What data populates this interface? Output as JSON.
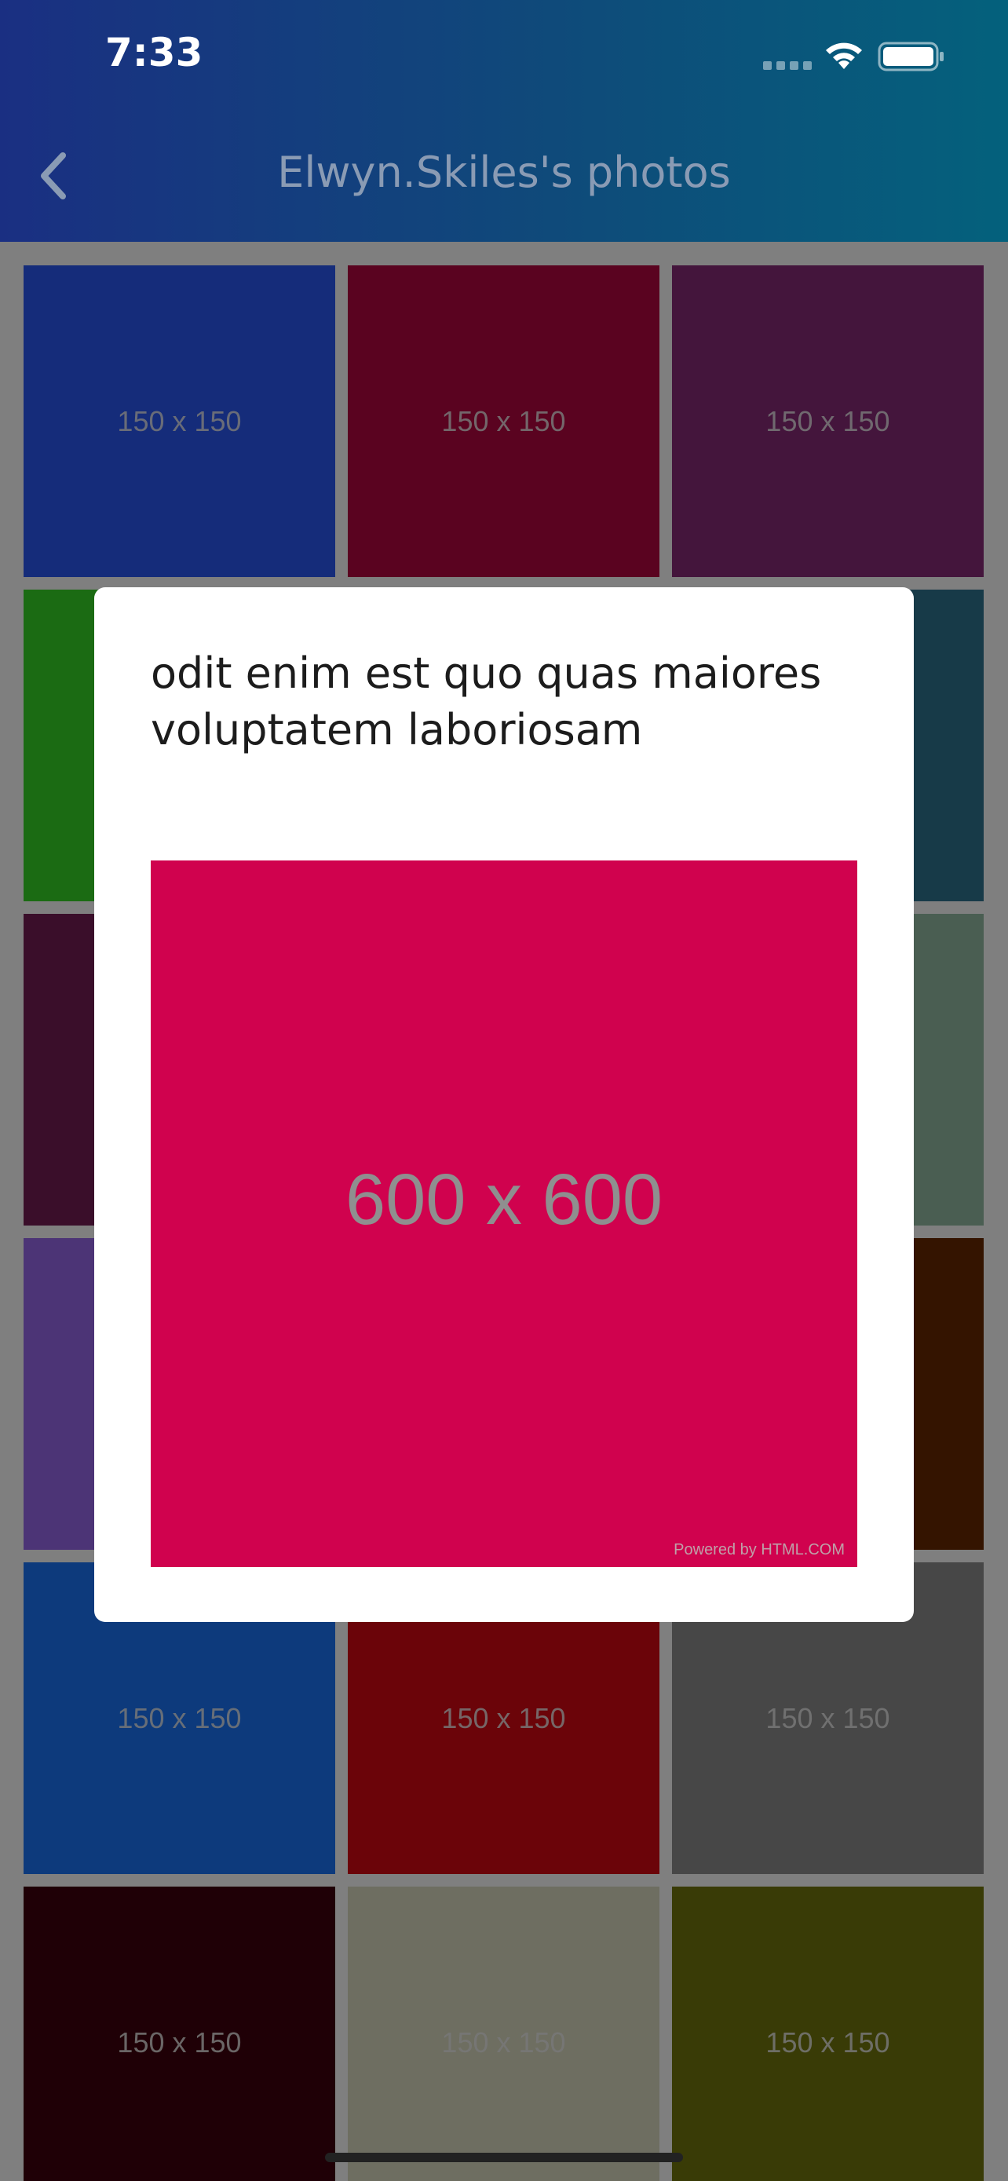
{
  "status_bar": {
    "time": "7:33"
  },
  "nav": {
    "title": "Elwyn.Skiles's photos",
    "back_icon": "chevron-left-icon"
  },
  "grid": {
    "tiles": [
      {
        "label": "150 x 150",
        "color": "#152c7a"
      },
      {
        "label": "150 x 150",
        "color": "#5a0320"
      },
      {
        "label": "150 x 150",
        "color": "#44153c"
      },
      {
        "label": "",
        "color": "#1b6b13"
      },
      {
        "label": "",
        "color": "#6b6b6b"
      },
      {
        "label": "",
        "color": "#173a48"
      },
      {
        "label": "",
        "color": "#3a0e2a"
      },
      {
        "label": "",
        "color": "#6b6b6b"
      },
      {
        "label": "",
        "color": "#4a5e52"
      },
      {
        "label": "",
        "color": "#4c3476"
      },
      {
        "label": "",
        "color": "#6b6b6b"
      },
      {
        "label": "",
        "color": "#341400"
      },
      {
        "label": "150 x 150",
        "color": "#0d3a7c"
      },
      {
        "label": "150 x 150",
        "color": "#6b0409"
      },
      {
        "label": "150 x 150",
        "color": "#474747"
      },
      {
        "label": "150 x 150",
        "color": "#1f0006"
      },
      {
        "label": "150 x 150",
        "color": "#6e6e61"
      },
      {
        "label": "150 x 150",
        "color": "#393b06"
      }
    ]
  },
  "modal": {
    "title": "odit enim est quo quas maiores voluptatem laboriosam",
    "photo_label": "600 x 600",
    "photo_credit": "Powered by HTML.COM",
    "photo_color": "#d0024e"
  }
}
